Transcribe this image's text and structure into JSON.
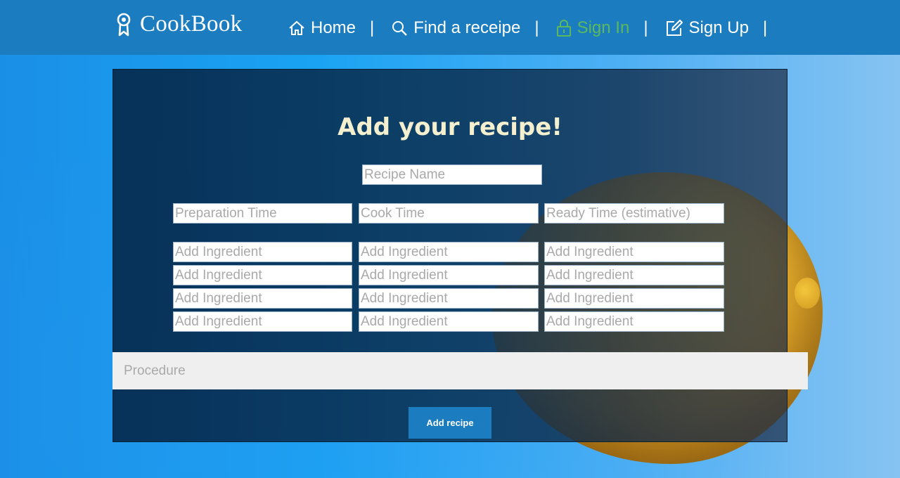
{
  "brand": {
    "name": "CookBook",
    "icon": "award-ribbon-icon"
  },
  "nav": {
    "items": [
      {
        "label": "Home",
        "icon": "home-icon"
      },
      {
        "label": "Find a receipe",
        "icon": "search-icon"
      },
      {
        "label": "Sign In",
        "icon": "lock-icon",
        "color": "#5cb85c"
      },
      {
        "label": "Sign Up",
        "icon": "edit-icon"
      }
    ],
    "separator": "|"
  },
  "form": {
    "title": "Add your recipe!",
    "recipe_name_placeholder": "Recipe Name",
    "times": {
      "prep_placeholder": "Preparation Time",
      "cook_placeholder": "Cook Time",
      "ready_placeholder": "Ready Time (estimative)"
    },
    "ingredient_placeholder": "Add Ingredient",
    "procedure_placeholder": "Procedure",
    "submit_label": "Add recipe"
  },
  "colors": {
    "header": "#1b7dc0",
    "active_link": "#5cb85c",
    "title": "#f4efcf",
    "button": "#1b7dc0"
  }
}
